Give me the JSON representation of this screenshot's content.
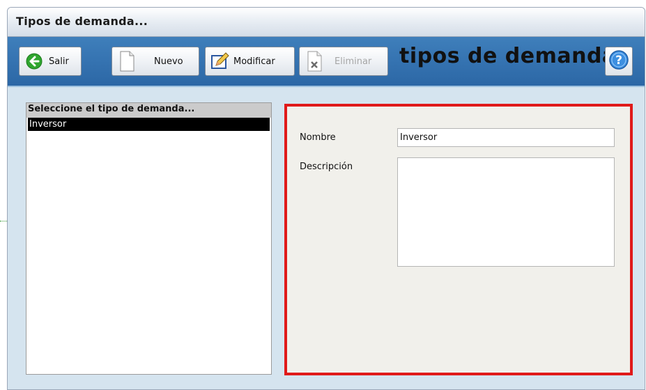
{
  "window": {
    "title": "Tipos de demanda..."
  },
  "toolbar": {
    "salir_label": "Salir",
    "nuevo_label": "Nuevo",
    "modificar_label": "Modificar",
    "eliminar_label": "Eliminar",
    "heading": "tipos de demanda",
    "icons": {
      "salir": "back-arrow-icon",
      "nuevo": "new-document-icon",
      "modificar": "edit-pencil-icon",
      "eliminar": "delete-document-icon",
      "help": "help-icon"
    }
  },
  "list": {
    "header": "Seleccione el tipo de demanda...",
    "items": [
      {
        "label": "Inversor",
        "selected": true
      }
    ]
  },
  "form": {
    "nombre_label": "Nombre",
    "nombre_value": "Inversor",
    "descripcion_label": "Descripción",
    "descripcion_value": ""
  },
  "colors": {
    "toolbar_bg": "#3573b1",
    "highlight_border": "#e01a1a",
    "selection_bg": "#000000"
  }
}
